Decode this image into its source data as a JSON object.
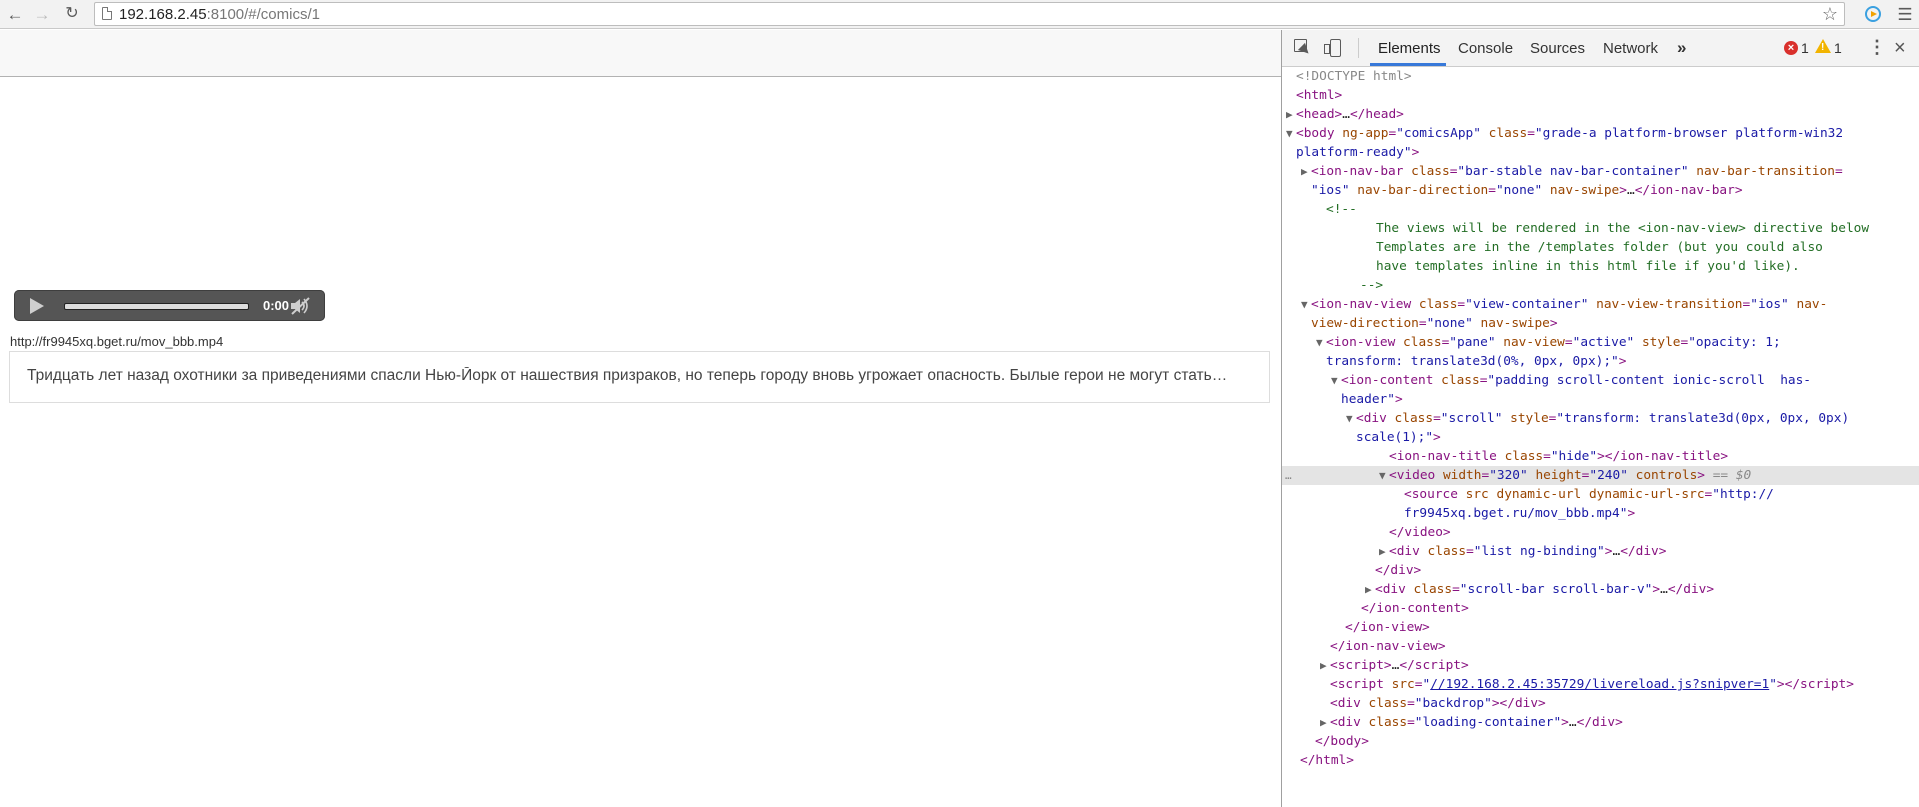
{
  "browser": {
    "url_host": "192.168.2.45",
    "url_rest": ":8100/#/comics/1"
  },
  "page": {
    "video": {
      "time": "0:00"
    },
    "source_url": "http://fr9945xq.bget.ru/mov_bbb.mp4",
    "description": "Тридцать лет назад охотники за приведениями спасли Нью-Йорк от нашествия призраков, но теперь городу вновь угрожает опасность. Былые герои не могут стать…"
  },
  "devtools": {
    "tabs": [
      "Elements",
      "Console",
      "Sources",
      "Network",
      "»"
    ],
    "errors": "1",
    "warnings": "1",
    "dom_lines": [
      {
        "indent": 14,
        "html": "<span class='g'>&lt;!DOCTYPE html&gt;</span>"
      },
      {
        "indent": 14,
        "html": "&lt;html&gt;"
      },
      {
        "indent": 14,
        "tri": "right",
        "html": "&lt;head&gt;<span class='k'>…</span>&lt;/head&gt;"
      },
      {
        "indent": 14,
        "tri": "down",
        "html": "&lt;body <span class='a'>ng-app</span>=<span class='v'>\"comicsApp\"</span> <span class='a'>class</span>=<span class='v'>\"grade-a platform-browser platform-win32</span>"
      },
      {
        "indent": 14,
        "html": "<span class='v'>platform-ready\"</span>&gt;"
      },
      {
        "indent": 29,
        "tri": "right",
        "html": "&lt;ion-nav-bar <span class='a'>class</span>=<span class='v'>\"bar-stable nav-bar-container\"</span> <span class='a'>nav-bar-transition</span>="
      },
      {
        "indent": 29,
        "html": "<span class='v'>\"ios\"</span> <span class='a'>nav-bar-direction</span>=<span class='v'>\"none\"</span> <span class='a'>nav-swipe</span>&gt;<span class='k'>…</span>&lt;/ion-nav-bar&gt;"
      },
      {
        "indent": 44,
        "html": "<span class='c'>&lt;!--</span>"
      },
      {
        "indent": 94,
        "html": "<span class='c'>The views will be rendered in the &lt;ion-nav-view&gt; directive below</span>"
      },
      {
        "indent": 94,
        "html": "<span class='c'>Templates are in the /templates folder (but you could also</span>"
      },
      {
        "indent": 94,
        "html": "<span class='c'>have templates inline in this html file if you'd like).</span>"
      },
      {
        "indent": 78,
        "html": "<span class='c'>--&gt;</span>"
      },
      {
        "indent": 29,
        "tri": "down",
        "html": "&lt;ion-nav-view <span class='a'>class</span>=<span class='v'>\"view-container\"</span> <span class='a'>nav-view-transition</span>=<span class='v'>\"ios\"</span> <span class='a'>nav-</span>"
      },
      {
        "indent": 29,
        "html": "<span class='a'>view-direction</span>=<span class='v'>\"none\"</span> <span class='a'>nav-swipe</span>&gt;"
      },
      {
        "indent": 44,
        "tri": "down",
        "html": "&lt;ion-view <span class='a'>class</span>=<span class='v'>\"pane\"</span> <span class='a'>nav-view</span>=<span class='v'>\"active\"</span> <span class='a'>style</span>=<span class='v'>\"opacity: 1;</span>"
      },
      {
        "indent": 44,
        "html": "<span class='v'>transform: translate3d(0%, 0px, 0px);\"</span>&gt;"
      },
      {
        "indent": 59,
        "tri": "down",
        "html": "&lt;ion-content <span class='a'>class</span>=<span class='v'>\"padding scroll-content ionic-scroll  has-</span>"
      },
      {
        "indent": 59,
        "html": "<span class='v'>header\"</span>&gt;"
      },
      {
        "indent": 74,
        "tri": "down",
        "html": "&lt;div <span class='a'>class</span>=<span class='v'>\"scroll\"</span> <span class='a'>style</span>=<span class='v'>\"transform: translate3d(0px, 0px, 0px)</span>"
      },
      {
        "indent": 74,
        "html": "<span class='v'>scale(1);\"</span>&gt;"
      },
      {
        "indent": 107,
        "html": "&lt;ion-nav-title <span class='a'>class</span>=<span class='v'>\"hide\"</span>&gt;&lt;/ion-nav-title&gt;"
      },
      {
        "indent": 107,
        "tri": "down",
        "sel": true,
        "html": "&lt;video <span class='a'>width</span>=<span class='v'>\"320\"</span> <span class='a'>height</span>=<span class='v'>\"240\"</span> <span class='a'>controls</span>&gt; <span class='g'>== <i>$0</i></span>"
      },
      {
        "indent": 122,
        "html": "&lt;source <span class='a'>src</span> <span class='a'>dynamic-url</span> <span class='a'>dynamic-url-src</span>=<span class='v'>\"http://</span>"
      },
      {
        "indent": 122,
        "html": "<span class='v'>fr9945xq.bget.ru/mov_bbb.mp4\"</span>&gt;"
      },
      {
        "indent": 107,
        "html": "&lt;/video&gt;"
      },
      {
        "indent": 107,
        "tri": "right",
        "html": "&lt;div <span class='a'>class</span>=<span class='v'>\"list ng-binding\"</span>&gt;<span class='k'>…</span>&lt;/div&gt;"
      },
      {
        "indent": 93,
        "html": "&lt;/div&gt;"
      },
      {
        "indent": 93,
        "tri": "right",
        "html": "&lt;div <span class='a'>class</span>=<span class='v'>\"scroll-bar scroll-bar-v\"</span>&gt;<span class='k'>…</span>&lt;/div&gt;"
      },
      {
        "indent": 79,
        "html": "&lt;/ion-content&gt;"
      },
      {
        "indent": 63,
        "html": "&lt;/ion-view&gt;"
      },
      {
        "indent": 48,
        "html": "&lt;/ion-nav-view&gt;"
      },
      {
        "indent": 48,
        "tri": "right",
        "html": "&lt;script&gt;<span class='k'>…</span>&lt;/script&gt;"
      },
      {
        "indent": 48,
        "html": "&lt;script <span class='a'>src</span>=<span class='v'>\"</span><span class='lnk'>//192.168.2.45:35729/livereload.js?snipver=1</span><span class='v'>\"</span>&gt;&lt;/script&gt;"
      },
      {
        "indent": 48,
        "html": "&lt;div <span class='a'>class</span>=<span class='v'>\"backdrop\"</span>&gt;&lt;/div&gt;"
      },
      {
        "indent": 48,
        "tri": "right",
        "html": "&lt;div <span class='a'>class</span>=<span class='v'>\"loading-container\"</span>&gt;<span class='k'>…</span>&lt;/div&gt;"
      },
      {
        "indent": 33,
        "html": "&lt;/body&gt;"
      },
      {
        "indent": 18,
        "html": "&lt;/html&gt;"
      }
    ]
  }
}
